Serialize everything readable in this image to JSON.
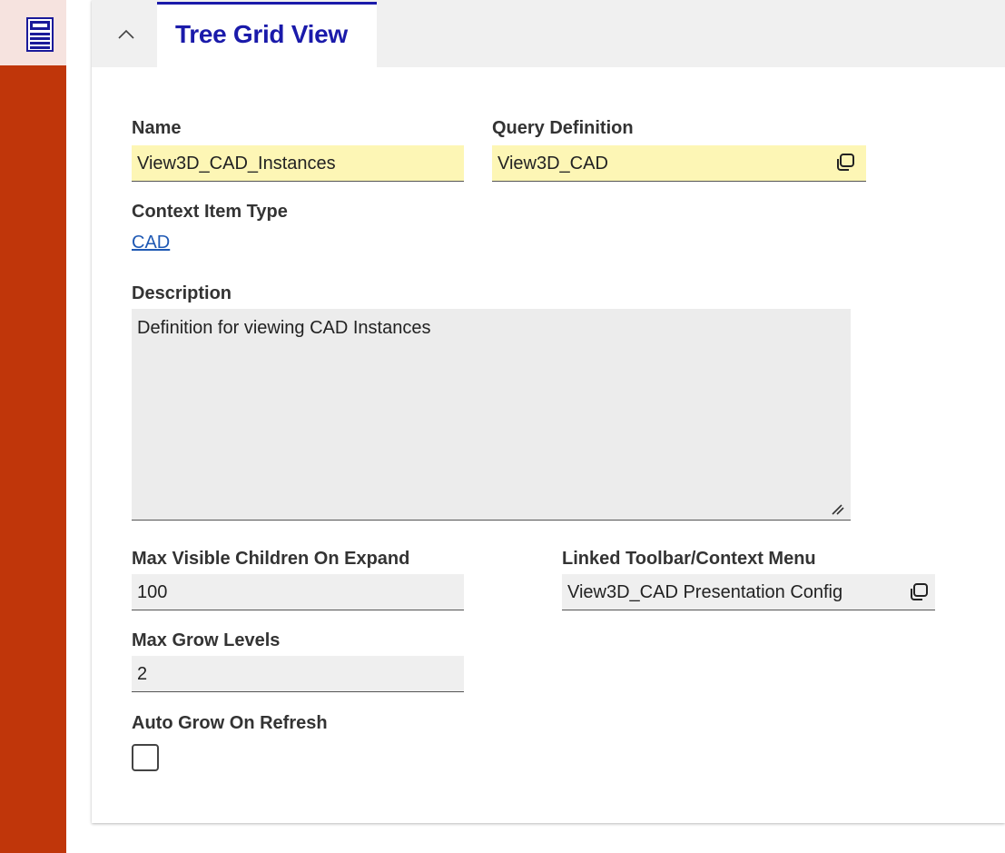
{
  "sidebar": {
    "icon": "form-view-icon"
  },
  "panel": {
    "tab_title": "Tree Grid View"
  },
  "form": {
    "name_label": "Name",
    "name_value": "View3D_CAD_Instances",
    "query_label": "Query Definition",
    "query_value": "View3D_CAD",
    "context_label": "Context Item Type",
    "context_value": "CAD",
    "description_label": "Description",
    "description_value": "Definition for viewing CAD Instances",
    "max_children_label": "Max Visible Children On Expand",
    "max_children_value": "100",
    "toolbar_label": "Linked Toolbar/Context Menu",
    "toolbar_value": "View3D_CAD Presentation Config",
    "max_grow_label": "Max Grow Levels",
    "max_grow_value": "2",
    "auto_grow_label": "Auto Grow On Refresh",
    "auto_grow_checked": false
  },
  "colors": {
    "accent": "#1a1aaa",
    "sidebar": "#c0360a",
    "required_field": "#fdf6b5",
    "link": "#1f59b4"
  }
}
